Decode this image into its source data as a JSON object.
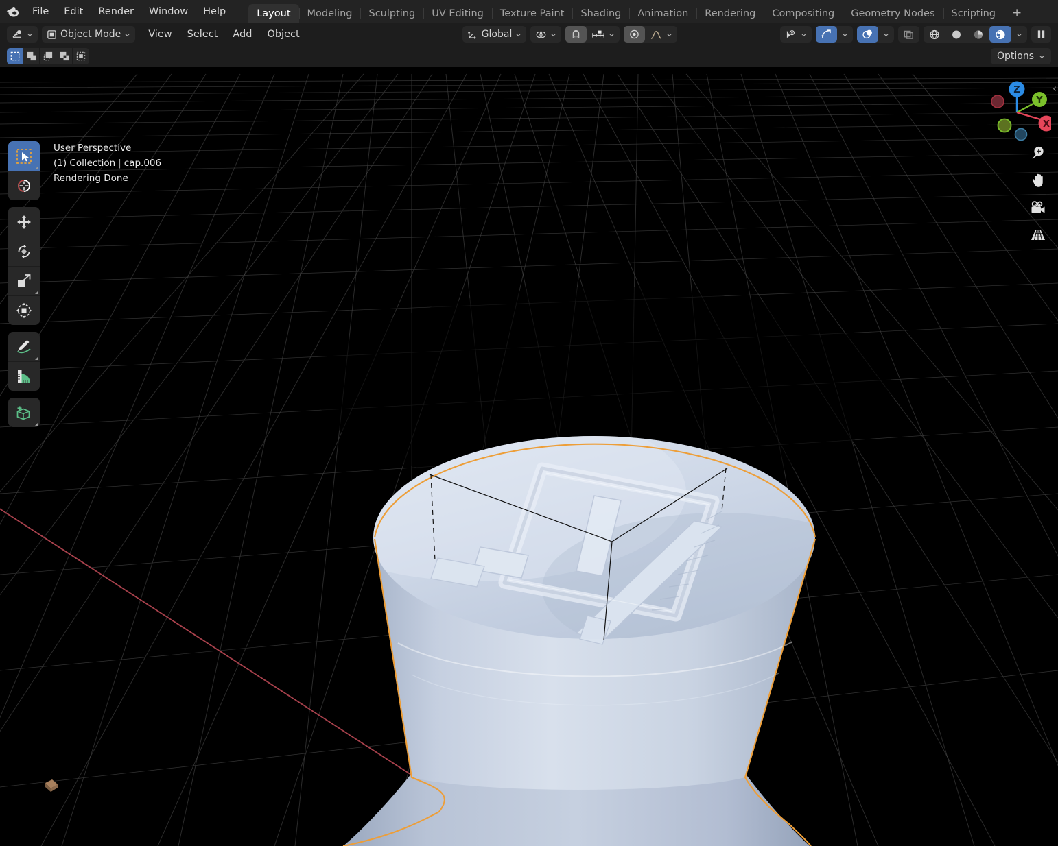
{
  "app": {
    "name": "Blender",
    "logo_icon": "blender-logo-icon"
  },
  "topbar": {
    "menus": [
      {
        "label": "File",
        "name": "file"
      },
      {
        "label": "Edit",
        "name": "edit"
      },
      {
        "label": "Render",
        "name": "render"
      },
      {
        "label": "Window",
        "name": "window"
      },
      {
        "label": "Help",
        "name": "help"
      }
    ],
    "workspace_tabs": [
      {
        "label": "Layout",
        "active": true
      },
      {
        "label": "Modeling",
        "active": false
      },
      {
        "label": "Sculpting",
        "active": false
      },
      {
        "label": "UV Editing",
        "active": false
      },
      {
        "label": "Texture Paint",
        "active": false
      },
      {
        "label": "Shading",
        "active": false
      },
      {
        "label": "Animation",
        "active": false
      },
      {
        "label": "Rendering",
        "active": false
      },
      {
        "label": "Compositing",
        "active": false
      },
      {
        "label": "Geometry Nodes",
        "active": false
      },
      {
        "label": "Scripting",
        "active": false
      }
    ],
    "add_workspace_label": "+"
  },
  "header": {
    "editor_type_icon": "editor-type-3dviewport-icon",
    "mode_icon": "object-mode-icon",
    "mode_label": "Object Mode",
    "menus": [
      {
        "label": "View"
      },
      {
        "label": "Select"
      },
      {
        "label": "Add"
      },
      {
        "label": "Object"
      }
    ],
    "transform_orientation": {
      "icon": "orientation-axes-icon",
      "label": "Global"
    },
    "pivot_icon": "pivot-point-icon",
    "snap_icon": "snap-magnet-icon",
    "snap_to_icon": "snap-increment-icon",
    "proportional_icon": "proportional-editing-icon",
    "falloff_icon": "falloff-smooth-icon",
    "right_controls": {
      "visibility_icon": "object-visibility-icon",
      "gizmo_icon": "show-gizmo-icon",
      "gizmo_on": true,
      "overlays_icon": "show-overlays-icon",
      "overlays_on": true,
      "xray_icon": "toggle-xray-icon",
      "shading_modes": [
        {
          "name": "wireframe",
          "icon": "shading-wireframe-icon",
          "active": false
        },
        {
          "name": "solid",
          "icon": "shading-solid-icon",
          "active": false
        },
        {
          "name": "material-preview",
          "icon": "shading-material-icon",
          "active": false
        },
        {
          "name": "rendered",
          "icon": "shading-rendered-icon",
          "active": true
        }
      ],
      "pause_icon": "pause-render-icon"
    }
  },
  "tool_settings": {
    "select_modes": [
      {
        "name": "set",
        "icon": "select-set-icon",
        "active": true
      },
      {
        "name": "extend",
        "icon": "select-extend-icon",
        "active": false
      },
      {
        "name": "subtract",
        "icon": "select-subtract-icon",
        "active": false
      },
      {
        "name": "invert",
        "icon": "select-invert-icon",
        "active": false
      },
      {
        "name": "intersect",
        "icon": "select-intersect-icon",
        "active": false
      }
    ],
    "options_label": "Options"
  },
  "toolbar": {
    "tools": [
      {
        "name": "tweak-select-box",
        "icon": "select-box-icon",
        "active": true,
        "has_submenu": true
      },
      {
        "name": "cursor",
        "icon": "3d-cursor-icon",
        "active": false,
        "has_submenu": false
      },
      {
        "name": "move",
        "icon": "move-icon",
        "active": false,
        "has_submenu": false
      },
      {
        "name": "rotate",
        "icon": "rotate-icon",
        "active": false,
        "has_submenu": false
      },
      {
        "name": "scale",
        "icon": "scale-icon",
        "active": false,
        "has_submenu": true
      },
      {
        "name": "transform",
        "icon": "transform-icon",
        "active": false,
        "has_submenu": false
      },
      {
        "name": "annotate",
        "icon": "annotate-pencil-icon",
        "active": false,
        "has_submenu": true
      },
      {
        "name": "measure",
        "icon": "measure-ruler-icon",
        "active": false,
        "has_submenu": false
      },
      {
        "name": "add-cube",
        "icon": "add-cube-icon",
        "active": false,
        "has_submenu": true
      }
    ]
  },
  "viewport": {
    "perspective_label": "User Perspective",
    "collection_label": "(1) Collection",
    "separator": "|",
    "object_name": "cap.006",
    "status_label": "Rendering Done",
    "background_color": "#000000",
    "grid_color": "#555555",
    "x_axis_color": "#a8414c",
    "selection_outline_color": "#ed9e38",
    "object_surface_color": "#c5cfe0",
    "small_object_color": "#9a7352"
  },
  "gizmo": {
    "axes": [
      {
        "label": "Z",
        "color": "#2b8ce6",
        "negative_color": "#1f4a73"
      },
      {
        "label": "Y",
        "color": "#7bc02b",
        "negative_color": "#4d6b1d"
      },
      {
        "label": "X",
        "color": "#e6465a",
        "negative_color": "#7a2630"
      }
    ]
  },
  "nav_buttons": [
    {
      "name": "zoom-view",
      "icon": "zoom-magnifier-icon"
    },
    {
      "name": "pan-view",
      "icon": "hand-pan-icon"
    },
    {
      "name": "camera-view",
      "icon": "camera-icon"
    },
    {
      "name": "toggle-perspective",
      "icon": "perspective-grid-icon"
    }
  ],
  "sidebar_toggle": {
    "icon": "chevron-left-icon",
    "label": "‹"
  }
}
